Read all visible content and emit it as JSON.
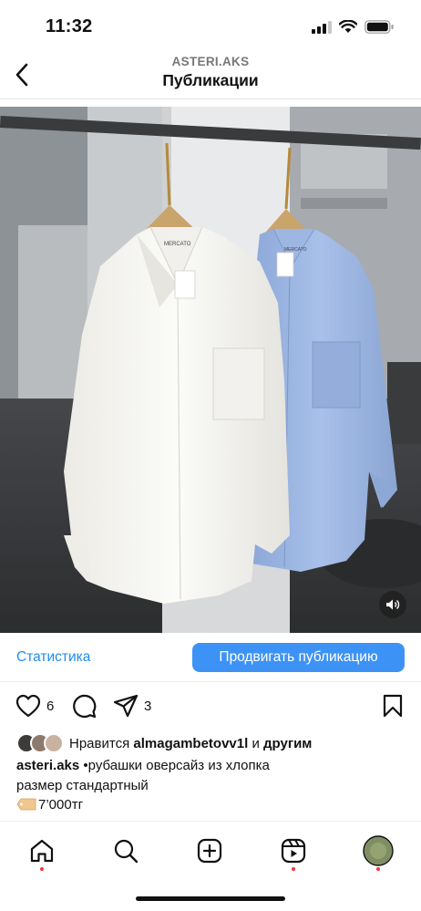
{
  "status_bar": {
    "time": "11:32"
  },
  "header": {
    "username": "ASTERI.AKS",
    "title": "Публикации"
  },
  "insights": {
    "stats_label": "Статистика",
    "promote_label": "Продвигать публикацию"
  },
  "actions": {
    "likes_count": "6",
    "shares_count": "3"
  },
  "likes": {
    "prefix": "Нравится",
    "user": "almagambetovv1l",
    "conjunction": "и",
    "others": "другим"
  },
  "caption": {
    "author": "asteri.aks",
    "text": "•рубашки оверсайз из хлопка",
    "line2": "размер стандартный",
    "price": "7’000тг"
  },
  "photo": {
    "hanger_tag": "MERCATO"
  },
  "colors": {
    "accent": "#3d93f5",
    "link": "#1f8cf0",
    "notification": "#ff3040"
  },
  "icons": [
    "back-icon",
    "heart-icon",
    "comment-icon",
    "share-icon",
    "bookmark-icon",
    "home-icon",
    "search-icon",
    "create-icon",
    "reels-icon",
    "profile-avatar",
    "speaker-icon",
    "price-tag-icon"
  ]
}
